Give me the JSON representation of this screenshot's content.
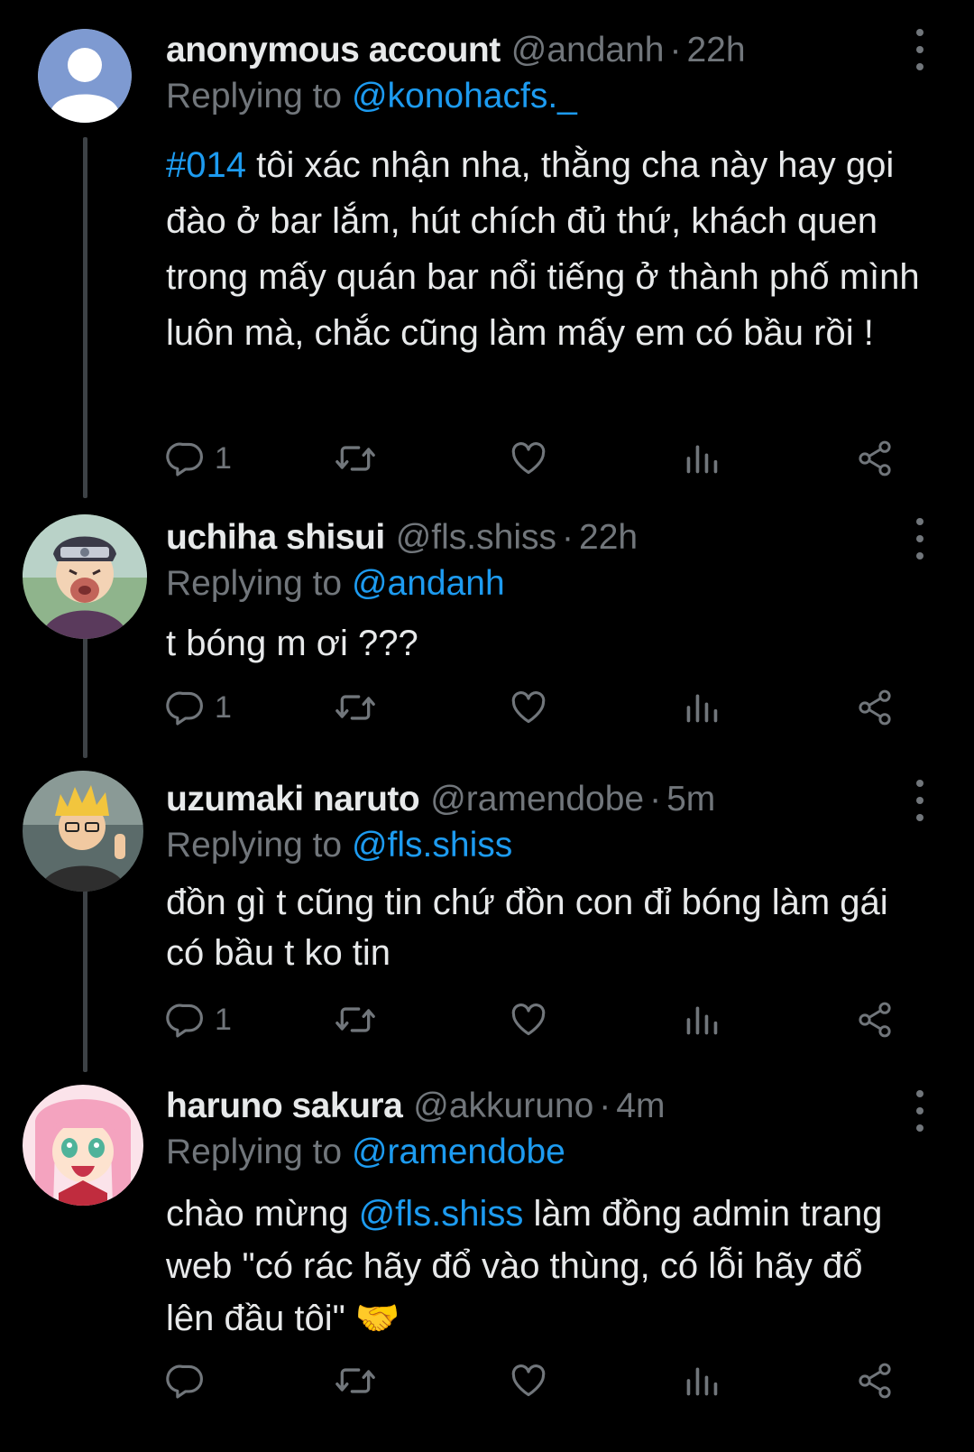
{
  "colors": {
    "background": "#000000",
    "text": "#e7e9ea",
    "muted": "#71767b",
    "accent": "#1d9bf0",
    "thread_line": "#3d4246"
  },
  "icons": {
    "reply": "reply-icon",
    "retweet": "retweet-icon",
    "like": "heart-icon",
    "views": "views-icon",
    "share": "share-icon",
    "more": "more-options-icon"
  },
  "tweets": [
    {
      "name": "anonymous account",
      "handle": "@andanh",
      "time": "22h",
      "replying_prefix": "Replying to ",
      "replying_to": "@konohacfs._",
      "hashtag": "#014",
      "text": " tôi xác nhận nha, thằng cha này hay gọi đào ở bar lắm, hút chích đủ thứ, khách quen trong mấy quán bar nổi tiếng ở thành phố mình luôn mà, chắc cũng làm mấy em có bầu rồi !",
      "reply_count": "1"
    },
    {
      "name": "uchiha shisui",
      "handle": "@fls.shiss",
      "time": "22h",
      "replying_prefix": "Replying to ",
      "replying_to": "@andanh",
      "text": "t bóng m ơi ???",
      "reply_count": "1"
    },
    {
      "name": "uzumaki naruto",
      "handle": "@ramendobe",
      "time": "5m",
      "replying_prefix": "Replying to ",
      "replying_to": "@fls.shiss",
      "text": "đồn gì t cũng tin chứ đồn con đỉ bóng làm gái có bầu t ko tin",
      "reply_count": "1"
    },
    {
      "name": "haruno sakura",
      "handle": "@akkuruno",
      "time": "4m",
      "replying_prefix": "Replying to ",
      "replying_to": "@ramendobe",
      "text_pre": "chào mừng ",
      "text_mention": "@fls.shiss",
      "text_post": " làm đồng admin trang web \"có rác hãy đổ vào thùng, có lỗi hãy đổ lên đầu tôi\" 🤝",
      "reply_count": ""
    }
  ]
}
